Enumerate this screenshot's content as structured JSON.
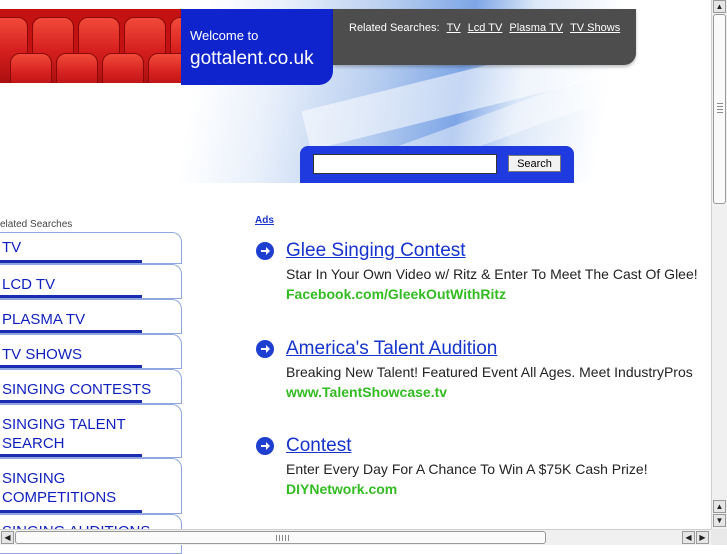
{
  "header": {
    "welcome_line1": "Welcome to",
    "welcome_line2": "gottalent.co.uk",
    "related_label": "Related Searches:",
    "related_links": [
      "TV",
      "Lcd TV",
      "Plasma TV",
      "TV Shows"
    ],
    "search_button": "Search",
    "search_value": ""
  },
  "sidebar": {
    "title": "elated Searches",
    "items": [
      {
        "label": "TV"
      },
      {
        "label": "LCD TV"
      },
      {
        "label": "PLASMA TV"
      },
      {
        "label": "TV SHOWS"
      },
      {
        "label": "SINGING CONTESTS"
      },
      {
        "label": "SINGING TALENT SEARCH"
      },
      {
        "label": "SINGING COMPETITIONS"
      },
      {
        "label": "SINGING AUDITIONS"
      }
    ]
  },
  "ads": {
    "label": "Ads",
    "items": [
      {
        "title": "Glee Singing Contest",
        "desc": "Star In Your Own Video w/ Ritz & Enter To Meet The Cast Of Glee!",
        "url": "Facebook.com/GleekOutWithRitz"
      },
      {
        "title": "America's Talent Audition",
        "desc": "Breaking New Talent! Featured Event All Ages. Meet IndustryPros",
        "url": "www.TalentShowcase.tv"
      },
      {
        "title": "Contest",
        "desc": "Enter Every Day For A Chance To Win A $75K Cash Prize!",
        "url": "DIYNetwork.com"
      }
    ]
  },
  "icons": {
    "ad_arrow": "arrow-right-circle-icon",
    "scroll_up": "arrow-up-icon",
    "scroll_down": "arrow-down-icon",
    "scroll_left": "arrow-left-icon",
    "scroll_right": "arrow-right-icon"
  },
  "colors": {
    "brand_blue": "#0f24cc",
    "link_blue": "#1633cc",
    "url_green": "#33bb22",
    "related_bar": "#4d4d4d",
    "seat_red": "#c41212"
  }
}
